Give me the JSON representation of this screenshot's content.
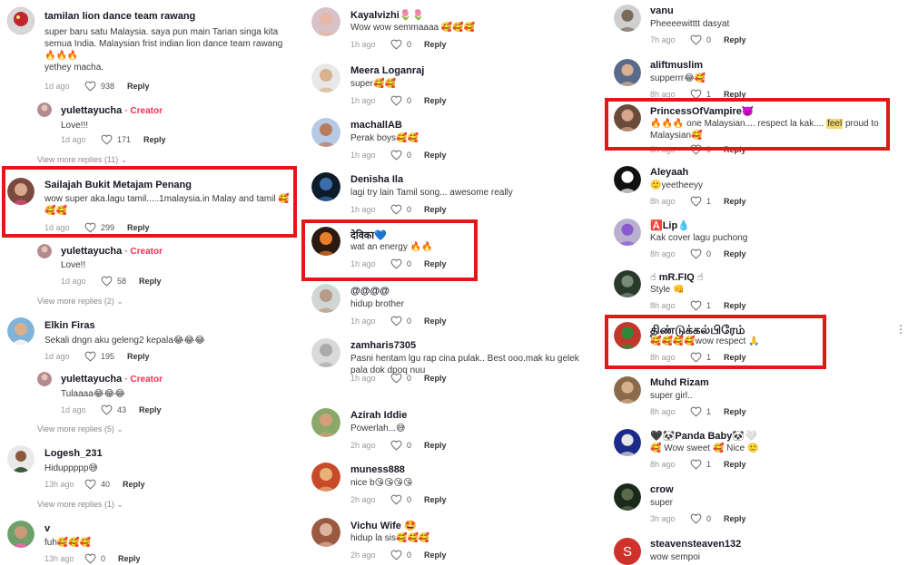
{
  "ui": {
    "reply_label": "Reply",
    "creator_label": "Creator"
  },
  "col1": [
    {
      "name": "tamilan lion dance team rawang",
      "text": "super baru satu Malaysia. saya pun main Tarian singa kita semua India. Malaysian frist indian lion dance team rawang 🔥🔥🔥",
      "text2": "yethey macha.",
      "age": "1d ago",
      "likes": "938"
    },
    {
      "name": "yulettayucha",
      "creator": "· Creator",
      "text": "Love!!!",
      "age": "1d ago",
      "likes": "171"
    },
    {
      "more": "View more replies (11)"
    },
    {
      "name": "Sailajah Bukit Metajam Penang",
      "text": "wow super aka.lagu tamil.....1malaysia.in Malay and tamil 🥰🥰🥰",
      "age": "1d ago",
      "likes": "299"
    },
    {
      "name": "yulettayucha",
      "creator": "· Creator",
      "text": "Love!!",
      "age": "1d ago",
      "likes": "58"
    },
    {
      "more": "View more replies (2)"
    },
    {
      "name": "Elkin Firas",
      "text": "Sekali dngn aku geleng2 kepala😂😂😂",
      "age": "1d ago",
      "likes": "195"
    },
    {
      "name": "yulettayucha",
      "creator": "· Creator",
      "text": "Tulaaaa😂😂😂",
      "age": "1d ago",
      "likes": "43"
    },
    {
      "more": "View more replies (5)"
    },
    {
      "name": "Logesh_231",
      "text": "Hiduppppp😅",
      "age": "13h ago",
      "likes": "40"
    },
    {
      "more": "View more replies (1)"
    },
    {
      "name": "v",
      "text": "fuh🥰🥰🥰",
      "age": "13h ago",
      "likes": "0"
    }
  ],
  "col2": [
    {
      "name": "Kayalvizhi🌷🌷",
      "text": "Wow wow semmaaaa 🥰🥰🥰",
      "age": "1h ago",
      "likes": "0"
    },
    {
      "name": "Meera Loganraj",
      "text": "super🥰🥰",
      "age": "1h ago",
      "likes": "0"
    },
    {
      "name": "machallAB",
      "text": "Perak boys🥰🥰",
      "age": "1h ago",
      "likes": "0"
    },
    {
      "name": "Denisha Ila",
      "text": "lagi try lain Tamil song... awesome really",
      "age": "1h ago",
      "likes": "0"
    },
    {
      "name": "देविका💙",
      "text": "wat an energy 🔥🔥",
      "age": "1h ago",
      "likes": "0"
    },
    {
      "name": "@@@@",
      "text": "hidup brother",
      "age": "1h ago",
      "likes": "0"
    },
    {
      "name": "zamharis7305",
      "text": "Pasni hentam lgu rap cina pulak.. Best ooo.mak ku gelek pala dok dpoq nuu",
      "age": "1h ago",
      "likes": "0"
    },
    {
      "name": "Azirah Iddie",
      "text": "Powerlah...😅",
      "age": "2h ago",
      "likes": "0"
    },
    {
      "name": "muness888",
      "text": "nice b😘😘😘😘",
      "age": "2h ago",
      "likes": "0"
    },
    {
      "name": "Vichu Wife 🤩",
      "text": "hidup la sis🥰🥰🥰",
      "age": "2h ago",
      "likes": "0"
    }
  ],
  "col3": [
    {
      "name": "vanu",
      "text": "Pheeeewitttt dasyat",
      "age": "7h ago",
      "likes": "0"
    },
    {
      "name": "aliftmuslim",
      "text": "supperrr😂🥰",
      "age": "8h ago",
      "likes": "1"
    },
    {
      "name": "PrincessOfVampire👿",
      "text_a": "🔥🔥🔥 one Malaysian.... respect la kak.... ",
      "text_mark": "feel",
      "text_b": " proud to Malaysian🥰",
      "age": "8h ago",
      "likes": "0"
    },
    {
      "name": "Aleyaah",
      "text": "🙂yeetheeyy",
      "age": "8h ago",
      "likes": "1"
    },
    {
      "name": "🅰️Lip💧",
      "text": "Kak cover lagu puchong",
      "age": "8h ago",
      "likes": "0"
    },
    {
      "name": "☝ mR.FIQ ☝",
      "text": "Style 👊",
      "age": "8h ago",
      "likes": "1"
    },
    {
      "name": "திண்டுக்கல்பிரேம்",
      "text": "🥰🥰🥰🥰wow respect 🙏",
      "age": "8h ago",
      "likes": "1"
    },
    {
      "name": "Muhd Rizam",
      "text": "super girl..",
      "age": "8h ago",
      "likes": "1"
    },
    {
      "name": "🖤🐼Panda Baby🐼🤍",
      "text": "🥰 Wow sweet 🥰 Nice 🙂",
      "age": "8h ago",
      "likes": "1"
    },
    {
      "name": "crow",
      "text": "super",
      "age": "3h ago",
      "likes": "0"
    },
    {
      "name": "steavensteaven132",
      "initial": "S",
      "text": "wow sempoi",
      "age": "",
      "likes": ""
    }
  ],
  "colors": {
    "highlight": "#e01818",
    "creator": "#fe2c55",
    "muted": "#9a9a9a",
    "avatar_s": "#d0322b"
  }
}
